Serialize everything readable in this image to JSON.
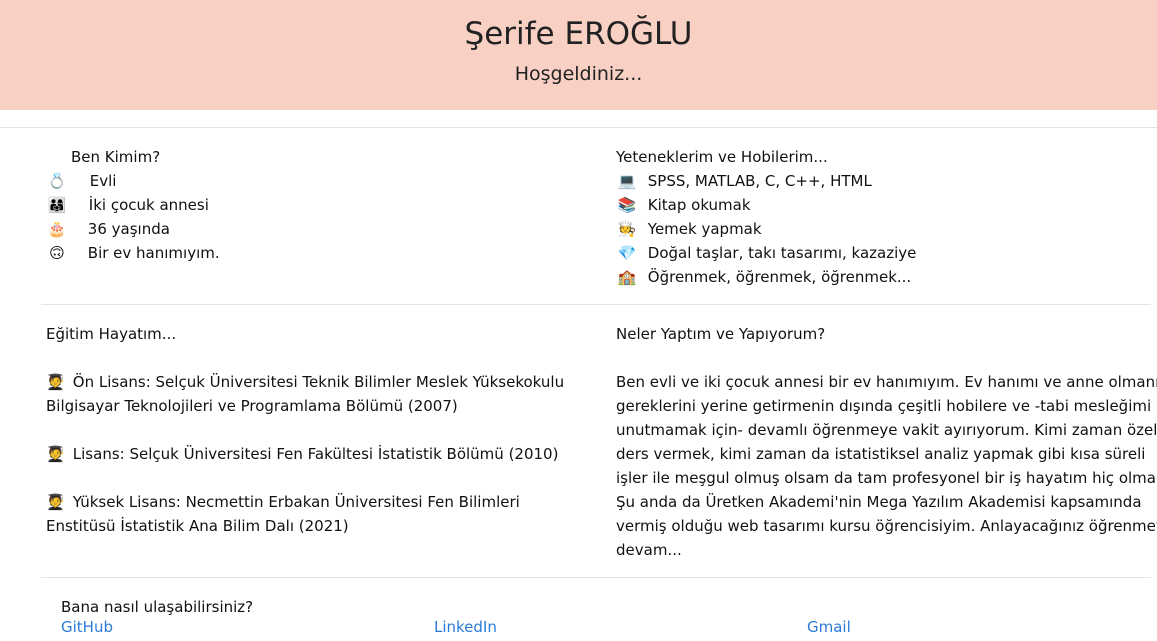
{
  "header": {
    "name": "Şerife EROĞLU",
    "welcome": "Hoşgeldiniz..."
  },
  "about": {
    "title": "Ben Kimim?",
    "items": [
      {
        "icon": "ring-icon",
        "glyph": "💍",
        "text": "Evli"
      },
      {
        "icon": "family-icon",
        "glyph": "👨‍👩‍👧",
        "text": "İki çocuk annesi"
      },
      {
        "icon": "cake-icon",
        "glyph": "🎂",
        "text": "36 yaşında"
      },
      {
        "icon": "smile-icon",
        "glyph": "🙃",
        "text": "Bir ev hanımıyım."
      }
    ]
  },
  "skills": {
    "title": "Yeteneklerim ve Hobilerim...",
    "items": [
      {
        "icon": "laptop-icon",
        "glyph": "💻",
        "text": "SPSS, MATLAB, C, C++, HTML"
      },
      {
        "icon": "books-icon",
        "glyph": "📚",
        "text": "Kitap okumak"
      },
      {
        "icon": "cook-icon",
        "glyph": "🧑‍🍳",
        "text": "Yemek yapmak"
      },
      {
        "icon": "gem-icon",
        "glyph": "💎",
        "text": "Doğal taşlar, takı tasarımı, kazaziye"
      },
      {
        "icon": "school-icon",
        "glyph": "🏫",
        "text": "Öğrenmek, öğrenmek, öğrenmek..."
      }
    ]
  },
  "education": {
    "title": "Eğitim Hayatım...",
    "items": [
      {
        "icon": "student-icon",
        "glyph": "🧑‍🎓",
        "line1": "Ön Lisans: Selçuk Üniversitesi Teknik Bilimler Meslek Yüksekokulu",
        "line2": "Bilgisayar Teknolojileri ve Programlama Bölümü (2007)"
      },
      {
        "icon": "student-icon",
        "glyph": "🧑‍🎓",
        "line1": "Lisans: Selçuk Üniversitesi Fen Fakültesi İstatistik Bölümü (2010)",
        "line2": ""
      },
      {
        "icon": "student-icon",
        "glyph": "🧑‍🎓",
        "line1": "Yüksek Lisans: Necmettin Erbakan Üniversitesi Fen Bilimleri",
        "line2": "Enstitüsü İstatistik Ana Bilim Dalı (2021)"
      }
    ]
  },
  "story": {
    "title": "Neler Yaptım ve Yapıyorum?",
    "lines": [
      "Ben evli ve iki çocuk annesi bir ev hanımıyım. Ev hanımı ve anne olmanın",
      "gereklerini yerine getirmenin dışında çeşitli hobilere ve -tabi mesleğimi",
      "unutmamak için- devamlı öğrenmeye vakit ayırıyorum. Kimi zaman özel",
      "ders vermek, kimi zaman da istatistiksel analiz yapmak gibi kısa süreli",
      "işler ile meşgul olmuş olsam da tam profesyonel bir iş hayatım hiç olmadı.",
      "Şu anda da Üretken Akademi'nin Mega Yazılım Akademisi kapsamında",
      "vermiş olduğu web tasarımı kursu öğrencisiyim. Anlayacağınız öğrenmeye",
      "devam..."
    ]
  },
  "contact": {
    "title": "Bana nasıl ulaşabilirsiniz?",
    "github": "GitHub",
    "linkedin": "LinkedIn",
    "gmail": "Gmail"
  }
}
